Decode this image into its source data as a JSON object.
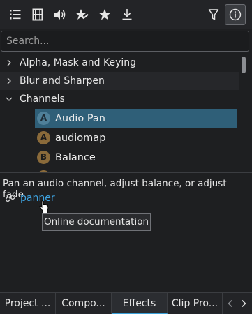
{
  "toolbar": {
    "buttons": [
      {
        "name": "list-view-icon"
      },
      {
        "name": "filmstrip-icon"
      },
      {
        "name": "audio-icon"
      },
      {
        "name": "custom-effects-icon"
      },
      {
        "name": "favorite-star-icon"
      },
      {
        "name": "download-icon"
      },
      {
        "name": "filter-icon"
      },
      {
        "name": "info-icon",
        "active": true
      }
    ]
  },
  "search": {
    "placeholder": "Search..."
  },
  "tree": {
    "categories": [
      {
        "label": "Alpha, Mask and Keying",
        "expanded": false
      },
      {
        "label": "Blur and Sharpen",
        "expanded": false
      },
      {
        "label": "Channels",
        "expanded": true
      }
    ],
    "items": [
      {
        "badge": "A",
        "label": "Audio Pan",
        "selected": true
      },
      {
        "badge": "A",
        "label": "audiomap",
        "selected": false
      },
      {
        "badge": "B",
        "label": "Balance",
        "selected": false
      }
    ]
  },
  "description": {
    "text": "Pan an audio channel, adjust balance, or adjust fade.",
    "link_text": "panner"
  },
  "tooltip": {
    "text": "Online documentation"
  },
  "tabs": [
    {
      "label": "Project ...",
      "active": false
    },
    {
      "label": "Compo...",
      "active": false
    },
    {
      "label": "Effects",
      "active": true
    },
    {
      "label": "Clip Pro...",
      "active": false
    }
  ],
  "colors": {
    "background": "#1e1f21",
    "selection": "#2f5f78",
    "link": "#3ea3e0",
    "tab_accent": "#3aa0d8"
  }
}
